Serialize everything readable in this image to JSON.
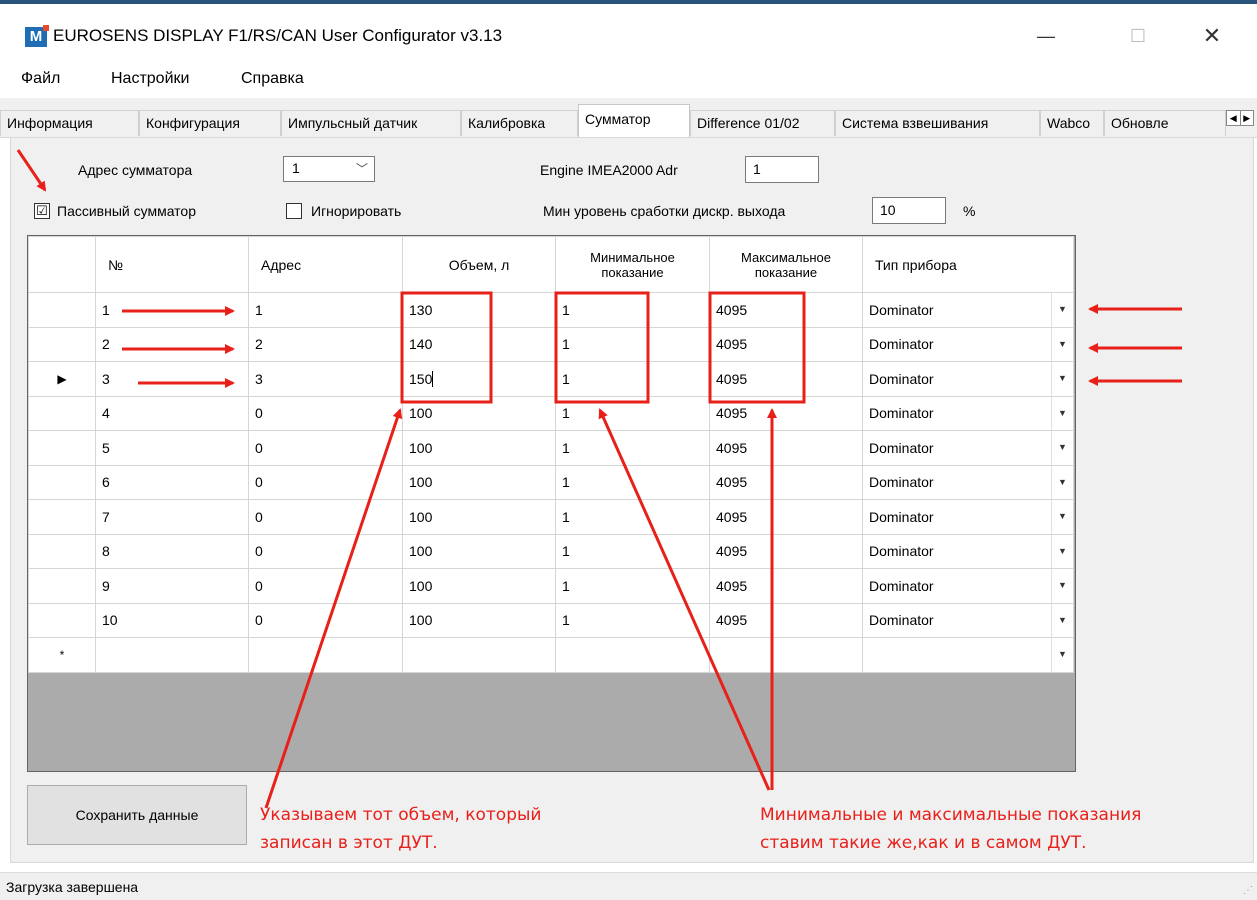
{
  "window": {
    "title": "EUROSENS DISPLAY F1/RS/CAN User Configurator v3.13",
    "icon_letter": "M",
    "controls": {
      "minimize": "—",
      "maximize": "☐",
      "close": "✕"
    }
  },
  "menu": [
    "Файл",
    "Настройки",
    "Справка"
  ],
  "tabs": [
    "Информация",
    "Конфигурация",
    "Импульсный датчик",
    "Калибровка",
    "Сумматор",
    "Difference 01/02",
    "Система взвешивания",
    "Wabco",
    "Обновле"
  ],
  "active_tab": "Сумматор",
  "form": {
    "address_label": "Адрес сумматора",
    "address_value": "1",
    "engine_label": "Engine IMEA2000 Adr",
    "engine_value": "1",
    "passive_label": "Пассивный сумматор",
    "passive_checked": "☑",
    "ignore_label": "Игнорировать",
    "min_level_label": "Мин уровень сработки дискр. выхода",
    "min_level_value": "10",
    "min_level_unit": "%"
  },
  "grid": {
    "columns": [
      "№",
      "Адрес",
      "Объем, л",
      "Минимальное показание",
      "Максимальное показание",
      "Тип прибора"
    ],
    "rows": [
      [
        "1",
        "1",
        "130",
        "1",
        "4095",
        "Dominator"
      ],
      [
        "2",
        "2",
        "140",
        "1",
        "4095",
        "Dominator"
      ],
      [
        "3",
        "3",
        "150",
        "1",
        "4095",
        "Dominator"
      ],
      [
        "4",
        "0",
        "100",
        "1",
        "4095",
        "Dominator"
      ],
      [
        "5",
        "0",
        "100",
        "1",
        "4095",
        "Dominator"
      ],
      [
        "6",
        "0",
        "100",
        "1",
        "4095",
        "Dominator"
      ],
      [
        "7",
        "0",
        "100",
        "1",
        "4095",
        "Dominator"
      ],
      [
        "8",
        "0",
        "100",
        "1",
        "4095",
        "Dominator"
      ],
      [
        "9",
        "0",
        "100",
        "1",
        "4095",
        "Dominator"
      ],
      [
        "10",
        "0",
        "100",
        "1",
        "4095",
        "Dominator"
      ]
    ],
    "current_row_marker": "▶",
    "new_row_marker": "*",
    "dropdown_glyph": "▼"
  },
  "save_button": "Сохранить данные",
  "annotations": {
    "volume_note": [
      "Указываем  тот объем, который",
      "записан в этот ДУТ."
    ],
    "minmax_note": [
      "Минимальные и максимальные показания",
      "ставим такие же,как и в самом ДУТ."
    ],
    "color": "#e8201a"
  },
  "status": "Загрузка завершена"
}
